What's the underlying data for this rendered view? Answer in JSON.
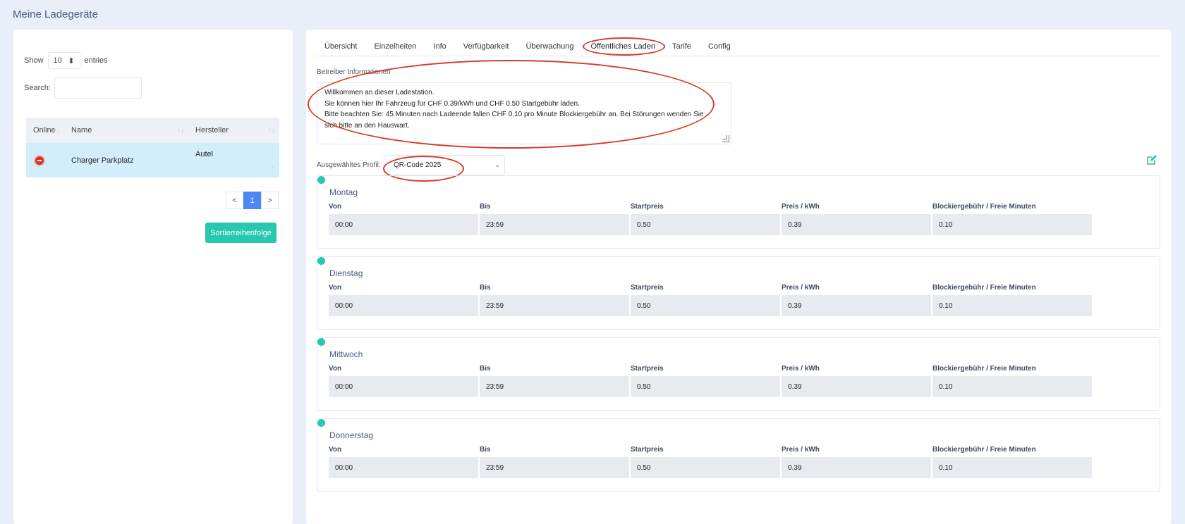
{
  "page": {
    "title": "Meine Ladegeräte"
  },
  "sidebar": {
    "show_label": "Show",
    "show_value": "10",
    "entries_label": "entries",
    "search_label": "Search:",
    "search_value": "",
    "columns": [
      "Online",
      "Name",
      "Hersteller"
    ],
    "rows": [
      {
        "online": "offline",
        "name": "Charger Parkplatz",
        "hersteller": "Autel",
        "hersteller_sub": "-"
      }
    ],
    "pager": {
      "prev": "<",
      "page": "1",
      "next": ">"
    },
    "sort_button": "Sortierreihenfolge"
  },
  "tabs": [
    "Übersicht",
    "Einzelheiten",
    "Info",
    "Verfügbarkeit",
    "Überwachung",
    "Öffentliches Laden",
    "Tarife",
    "Config"
  ],
  "active_tab": "Öffentliches Laden",
  "operator": {
    "label": "Betreiber Informationen",
    "lines": [
      "Willkommen an dieser Ladestation.",
      "Sie können hier Ihr Fahrzeug für CHF 0.39/kWh und CHF 0.50 Startgebühr laden.",
      "Bitte beachten Sie: 45 Minuten nach Ladeende fallen CHF 0.10 pro Minute Blockiergebühr an. Bei Störungen wenden Sie",
      "sich bitte an den Hauswart."
    ]
  },
  "profile": {
    "label": "Ausgewähltes Profil:",
    "value": "QR-Code 2025"
  },
  "columns": [
    "Von",
    "Bis",
    "Startpreis",
    "Preis / kWh",
    "Blockiergebühr / Freie Minuten"
  ],
  "days": [
    {
      "name": "Montag",
      "values": [
        "00:00",
        "23:59",
        "0.50",
        "0.39",
        "0.10"
      ]
    },
    {
      "name": "Dienstag",
      "values": [
        "00:00",
        "23:59",
        "0.50",
        "0.39",
        "0.10"
      ]
    },
    {
      "name": "Mittwoch",
      "values": [
        "00:00",
        "23:59",
        "0.50",
        "0.39",
        "0.10"
      ]
    },
    {
      "name": "Donnerstag",
      "values": [
        "00:00",
        "23:59",
        "0.50",
        "0.39",
        "0.10"
      ]
    }
  ],
  "colors": {
    "accent": "#27c7b0",
    "annotation": "#d23c29",
    "page_active": "#4f86f7",
    "offline": "#d9322b"
  }
}
